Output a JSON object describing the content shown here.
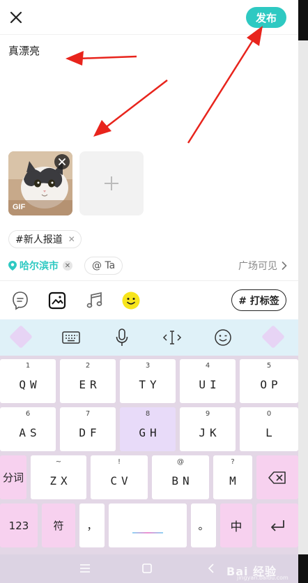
{
  "header": {
    "publish_label": "发布"
  },
  "post": {
    "text": "真漂亮"
  },
  "media": {
    "gif_label": "GIF"
  },
  "topic": {
    "label": "#新人报道"
  },
  "location": {
    "label": "哈尔滨市",
    "at_label": "@ Ta",
    "visibility_label": "广场可见"
  },
  "toolbar": {
    "tag_label": "# 打标签"
  },
  "keyboard": {
    "row1": [
      {
        "hint": "1",
        "label": "QW"
      },
      {
        "hint": "2",
        "label": "ER"
      },
      {
        "hint": "3",
        "label": "TY"
      },
      {
        "hint": "4",
        "label": "UI"
      },
      {
        "hint": "5",
        "label": "OP"
      }
    ],
    "row2": [
      {
        "hint": "6",
        "label": "AS"
      },
      {
        "hint": "7",
        "label": "DF"
      },
      {
        "hint": "8",
        "label": "GH"
      },
      {
        "hint": "9",
        "label": "JK"
      },
      {
        "hint": "0",
        "label": "L"
      }
    ],
    "row3": [
      {
        "hint": "",
        "label": "分词"
      },
      {
        "hint": "~",
        "label": "ZX"
      },
      {
        "hint": "!",
        "label": "CV"
      },
      {
        "hint": "@",
        "label": "BN"
      },
      {
        "hint": "?",
        "label": "M"
      }
    ],
    "row4": [
      {
        "label": "123"
      },
      {
        "label": "符"
      },
      {
        "label": "，"
      },
      {
        "label": ""
      },
      {
        "label": "。"
      },
      {
        "label": "中"
      }
    ]
  },
  "watermark": {
    "text": "Bai 经验",
    "sub": "jingyan.baidu.com"
  },
  "colors": {
    "accent": "#2ec9c2",
    "arrow": "#e8241c",
    "ime_bar": "#dff1f8",
    "keyboard_bg": "#e3d7e6",
    "key_pink": "#f7d1ef",
    "key_purple": "#e8dbf9"
  },
  "icons": {
    "close": "close-icon",
    "remove": "close-small-icon",
    "add": "plus-icon",
    "location": "location-pin-icon",
    "chevron": "chevron-right-icon",
    "voice": "voice-bubble-icon",
    "image": "image-icon",
    "music": "music-note-icon",
    "emoji": "emoji-icon",
    "keyboard": "keyboard-icon",
    "mic": "microphone-icon",
    "cursor": "cursor-move-icon",
    "smiley": "smiley-icon",
    "backspace": "backspace-icon",
    "enter": "enter-icon"
  }
}
